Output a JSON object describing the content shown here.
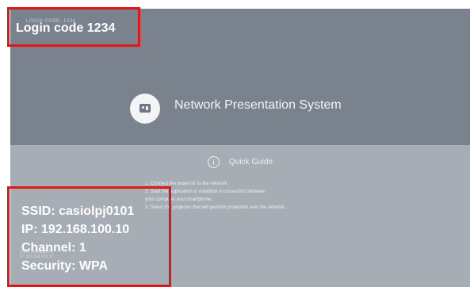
{
  "login": {
    "faint_text": "LOGIN CODE: 1234",
    "overlay_text": "Login code 1234"
  },
  "main": {
    "app_title": "Network Presentation System",
    "logo_icon": "projector-logo-icon"
  },
  "quick_guide": {
    "icon": "info-icon",
    "title": "Quick Guide",
    "steps": [
      "1. Connect the projector to the network.",
      "2. Start the application to establish a connection between",
      "    your computer and smartphone.",
      "3. Select the projector that will perform projection over the network."
    ]
  },
  "network_faint": [
    "SSID: casiolpj0101",
    "IP: 192.168.100.10"
  ],
  "network_overlay": {
    "ssid": "SSID: casiolpj0101",
    "ip": "IP: 192.168.100.10",
    "channel": "Channel: 1",
    "security": "Security: WPA"
  },
  "colors": {
    "highlight": "#e11717",
    "top_band": "#7a838d",
    "bottom_band": "#a6adb5"
  }
}
